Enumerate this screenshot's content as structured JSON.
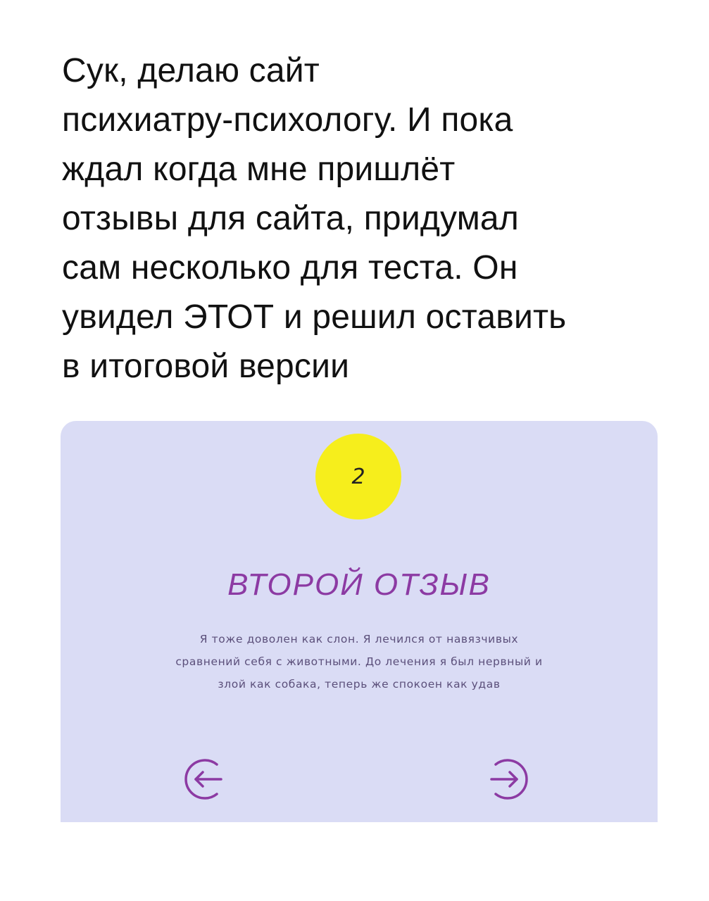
{
  "post": {
    "lines": [
      "Сук, делаю сайт",
      "психиатру-психологу. И пока",
      "ждал когда мне пришлёт",
      "отзывы для сайта, придумал",
      "сам несколько для теста. Он",
      "увидел ЭТОТ и решил оставить",
      "в итоговой версии"
    ]
  },
  "review_card": {
    "number": "2",
    "title": "ВТОРОЙ ОТЗЫВ",
    "text_lines": [
      "Я тоже доволен как слон. Я лечился от навязчивых",
      "сравнений себя с животными. До лечения я был нервный и",
      "злой как собака, теперь же спокоен как удав"
    ],
    "prev_icon": "arrow-left-circle-icon",
    "next_icon": "arrow-right-circle-icon"
  },
  "colors": {
    "card_background": "#dadcf5",
    "badge": "#f6ee1c",
    "accent": "#8c3aa3"
  }
}
